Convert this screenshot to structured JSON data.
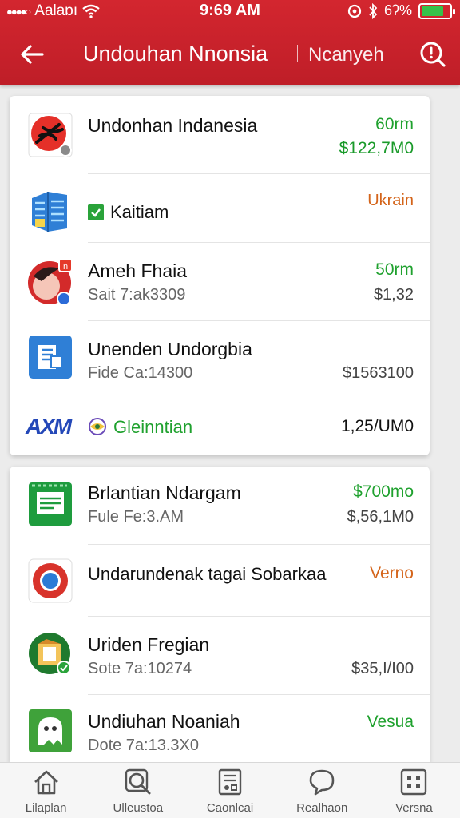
{
  "status_bar": {
    "carrier": "Aalaɒı",
    "time": "9:69 AM",
    "battery_text": "6ʔ%",
    "battery_level": 0.8,
    "battery_color": "#36c24a"
  },
  "header": {
    "title": "Undouhan Nnonsia",
    "subtitle": "Ncanyeh",
    "back_icon": "arrow-left-icon",
    "search_icon": "search-icon",
    "color": "#c8222c"
  },
  "list_group_1": [
    {
      "icon": "red-app-icon",
      "name": "Undonhan Indanesia",
      "sub": "",
      "right_top": "60rm",
      "right_bottom": "$122,7M0"
    },
    {
      "icon": "blue-building-icon",
      "name": "",
      "sub": "",
      "badge_label": "Kaitiam",
      "right_top": "Ukrain",
      "right_bottom": ""
    },
    {
      "icon": "face-app-icon",
      "name": "Ameh Fhaia",
      "sub": "Sait 7:ak3309",
      "right_top": "50rm",
      "right_bottom": "$1,32"
    },
    {
      "icon": "blue-document-icon",
      "name": "Unenden Undorgbia",
      "sub": "Fide Ca:14300",
      "right_top": "",
      "right_bottom": "$1563100"
    },
    {
      "icon": "axm-logo-icon",
      "logo_text": "AXM",
      "name": "",
      "sub": "",
      "badge_label": "Gleinntian",
      "right_top": "",
      "right_bottom": "1,25/UM0"
    }
  ],
  "list_group_2": [
    {
      "icon": "green-sheet-icon",
      "name": "Brlantian Ndargam",
      "sub": "Fule Fe:3.AM",
      "right_top": "$700mo",
      "right_bottom": "$,56,1M0"
    },
    {
      "icon": "chrome-icon",
      "name": "Undarundenak tagai Sobarkaa",
      "sub": "",
      "right_top": "Verno",
      "right_bottom": ""
    },
    {
      "icon": "folder-app-icon",
      "name": "Uriden Fregian",
      "sub": "Sote 7a:10274",
      "right_top": "",
      "right_bottom": "$35,I/I00"
    },
    {
      "icon": "ghost-app-icon",
      "name": "Undiuhan Noaniah",
      "sub": "Dote 7a:13.3X0",
      "right_top": "Vesua",
      "right_bottom": ""
    }
  ],
  "tabs": [
    {
      "icon": "home-icon",
      "label": "Lilaplan"
    },
    {
      "icon": "magnifier-icon",
      "label": "Ulleustoa"
    },
    {
      "icon": "document-icon",
      "label": "Caonlcai"
    },
    {
      "icon": "chat-bubble-icon",
      "label": "Realhaon"
    },
    {
      "icon": "grid-icon",
      "label": "Versna"
    }
  ]
}
